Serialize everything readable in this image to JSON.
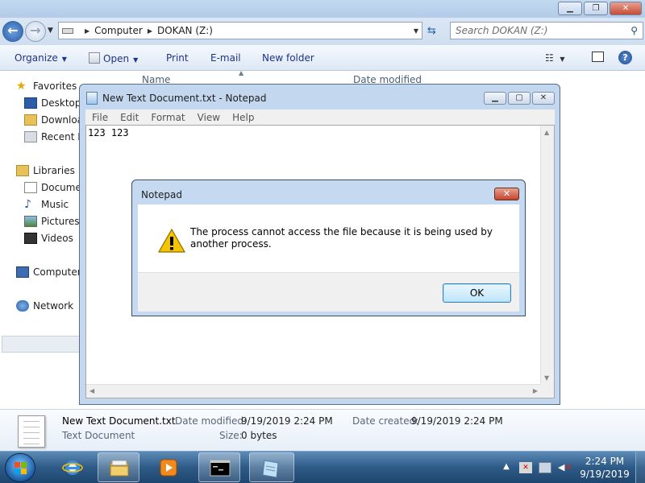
{
  "explorer": {
    "address": {
      "root": "Computer",
      "location": "DOKAN (Z:)"
    },
    "search_placeholder": "Search DOKAN (Z:)",
    "toolbar": {
      "organize": "Organize",
      "open": "Open",
      "print": "Print",
      "email": "E-mail",
      "new_folder": "New folder"
    },
    "sidebar": {
      "favorites": "Favorites",
      "desktop": "Desktop",
      "downloads": "Downloa",
      "recent": "Recent P",
      "libraries": "Libraries",
      "documents": "Documer",
      "music": "Music",
      "pictures": "Pictures",
      "videos": "Videos",
      "computer": "Computer",
      "network": "Network"
    },
    "columns": {
      "name": "Name",
      "date_modified": "Date modified"
    },
    "details": {
      "file_name": "New Text Document.txt",
      "file_type": "Text Document",
      "date_modified_label": "Date modified:",
      "date_modified": "9/19/2019 2:24 PM",
      "date_created_label": "Date created:",
      "date_created": "9/19/2019 2:24 PM",
      "size_label": "Size:",
      "size": "0 bytes"
    }
  },
  "notepad": {
    "title": "New Text Document.txt - Notepad",
    "menu": [
      "File",
      "Edit",
      "Format",
      "View",
      "Help"
    ],
    "content": "123 123"
  },
  "dialog": {
    "title": "Notepad",
    "message": "The process cannot access the file because it is being used by another process.",
    "ok": "OK"
  },
  "taskbar": {
    "clock_time": "2:24 PM",
    "clock_date": "9/19/2019"
  }
}
